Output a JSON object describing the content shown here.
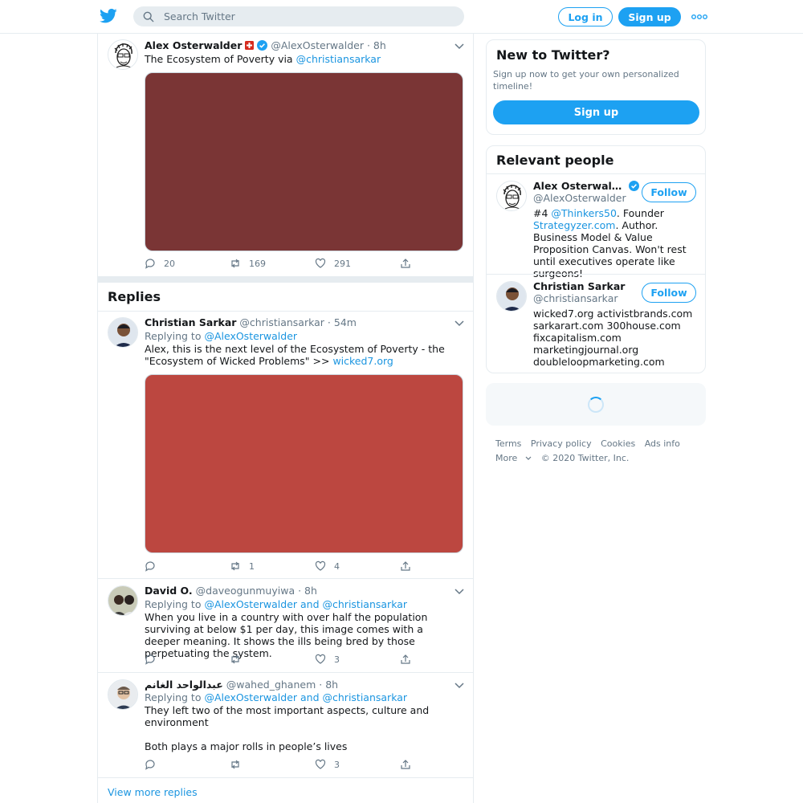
{
  "header": {
    "search_placeholder": "Search Twitter",
    "login_label": "Log in",
    "signup_label": "Sign up"
  },
  "main_tweet": {
    "name": "Alex Osterwalder",
    "handle": "@AlexOsterwalder",
    "time": "· 8h",
    "text_prefix": "The Ecosystem of Poverty via ",
    "mention": "@christiansarkar",
    "media_color": "#7a3535",
    "replies": "20",
    "retweets": "169",
    "likes": "291"
  },
  "replies_title": "Replies",
  "replies": [
    {
      "name": "Christian Sarkar",
      "handle": "@christiansarkar",
      "time": "· 54m",
      "replying_label": "Replying to ",
      "replying_to": "@AlexOsterwalder",
      "text": "Alex, this is the next level of the Ecosystem of Poverty - the \"Ecosystem of Wicked Problems\" >> ",
      "link": "wicked7.org",
      "media_color": "#bc4740",
      "replies": "",
      "retweets": "1",
      "likes": "4"
    },
    {
      "name": "David O.",
      "handle": "@daveogunmuyiwa",
      "time": "· 8h",
      "replying_label": "Replying to ",
      "replying_to": "@AlexOsterwalder and @christiansarkar",
      "text": "When you live in a country with over half the population surviving at below $1 per day, this image comes with a deeper meaning. It shows the ills being bred by those perpetuating the system.",
      "replies": "",
      "retweets": "",
      "likes": "3"
    },
    {
      "name": "عبدالواحد الغانم",
      "handle": "@wahed_ghanem",
      "time": "· 8h",
      "replying_label": "Replying to ",
      "replying_to": "@AlexOsterwalder and @christiansarkar",
      "text_line1": "They left two of the most important aspects, culture and environment",
      "text_line2": "Both plays a major rolls in people’s lives",
      "replies": "",
      "retweets": "",
      "likes": "3"
    }
  ],
  "view_more": "View more replies",
  "sidebar": {
    "new_title": "New to Twitter?",
    "new_subtitle": "Sign up now to get your own personalized timeline!",
    "signup_label": "Sign up",
    "relevant_title": "Relevant people",
    "people": [
      {
        "name": "Alex Osterwal…",
        "handle": "@AlexOsterwalder",
        "follow_label": "Follow",
        "bio_prefix": "#4 ",
        "bio_mention": "@Thinkers50",
        "bio_mid": ". Founder ",
        "bio_link": "Strategyzer.com",
        "bio_rest": ". Author. Business Model & Value Proposition Canvas. Won't rest until executives operate like surgeons!"
      },
      {
        "name": "Christian Sarkar",
        "handle": "@christiansarkar",
        "follow_label": "Follow",
        "links": [
          "wicked7.org activistbrands.com",
          "sarkarart.com 300house.com",
          "fixcapitalism.com",
          "marketingjournal.org",
          "doubleloopmarketing.com"
        ]
      }
    ]
  },
  "footer": {
    "terms": "Terms",
    "privacy": "Privacy policy",
    "cookies": "Cookies",
    "ads": "Ads info",
    "more": "More",
    "copyright": "© 2020 Twitter, Inc."
  },
  "colors": {
    "accent": "#1da1f2",
    "link": "#1b95e0",
    "muted": "#657786",
    "border": "#e6ecf0"
  }
}
